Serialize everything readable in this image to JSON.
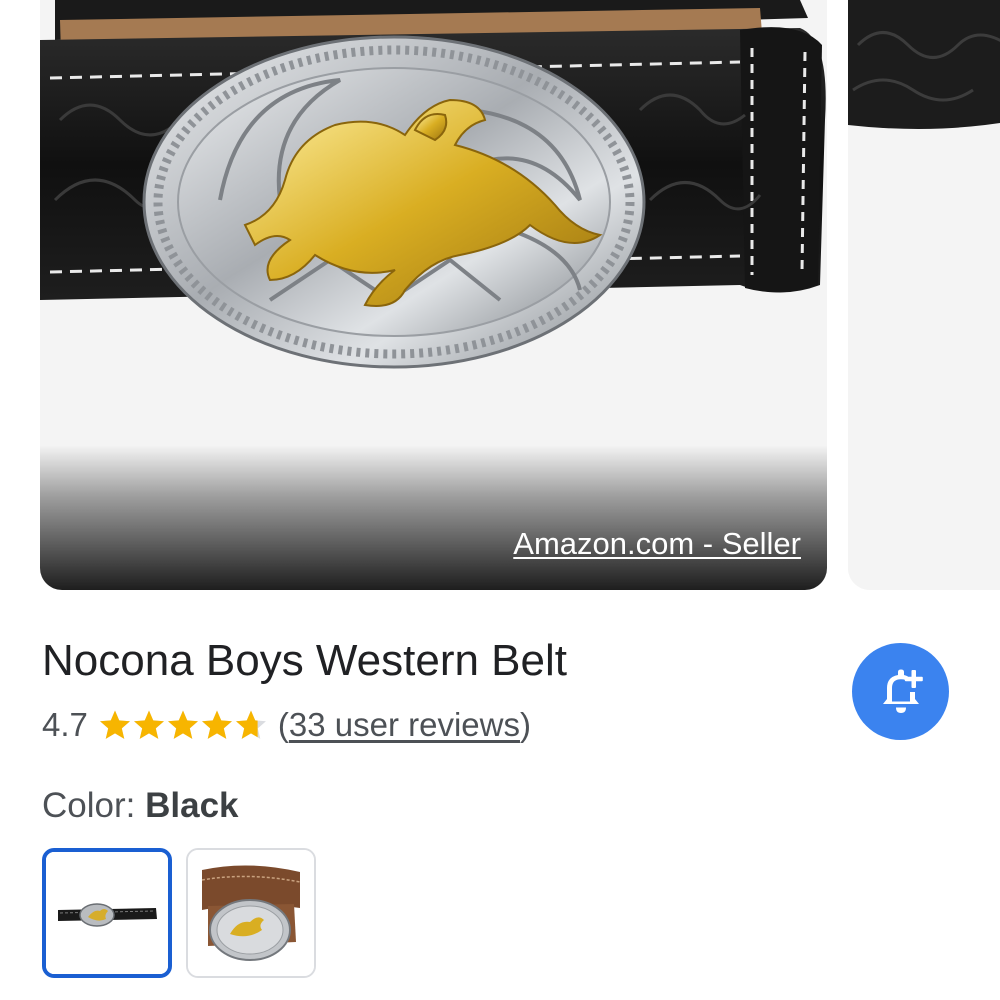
{
  "carousel": {
    "main_image": {
      "alt": "Black tooled leather western belt with oval silver buckle and gold bull rider",
      "source_label": "Amazon.com - Seller"
    }
  },
  "product": {
    "title": "Nocona Boys Western Belt",
    "rating": {
      "value": "4.7",
      "stars": 4.7,
      "max_stars": 5,
      "reviews_open": "(",
      "reviews_text": "33 user reviews",
      "reviews_close": ")"
    },
    "alert_button": {
      "icon": "bell-plus-icon"
    }
  },
  "color_selector": {
    "label": "Color:",
    "selected_value": "Black",
    "options": [
      {
        "name": "black",
        "selected": true
      },
      {
        "name": "brown",
        "selected": false
      }
    ]
  },
  "colors": {
    "star": "#f7b500",
    "star_empty": "#dadce0",
    "alert_button": "#3b83ef",
    "selected_border": "#1a5fd2",
    "text_primary": "#202124",
    "text_secondary": "#4d5156"
  }
}
